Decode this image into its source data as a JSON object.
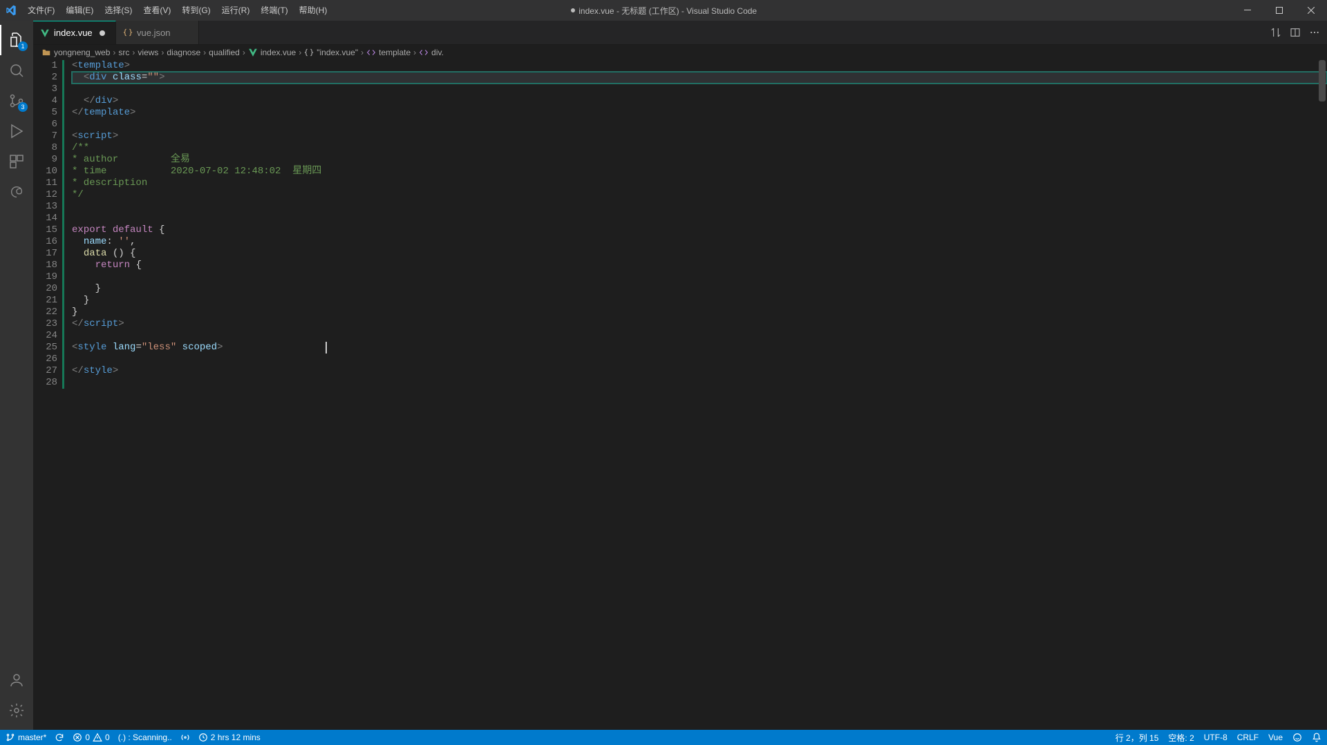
{
  "menu": {
    "file": "文件(F)",
    "edit": "编辑(E)",
    "selection": "选择(S)",
    "view": "查看(V)",
    "go": "转到(G)",
    "run": "运行(R)",
    "terminal": "终端(T)",
    "help": "帮助(H)"
  },
  "window": {
    "title_prefix": "● ",
    "title": "index.vue - 无标题 (工作区) - Visual Studio Code"
  },
  "activity": {
    "explorer_badge": "1",
    "scm_badge": "3"
  },
  "tabs": [
    {
      "label": "index.vue",
      "icon": "vue-file-icon",
      "active": true,
      "dirty": true
    },
    {
      "label": "vue.json",
      "icon": "json-file-icon",
      "active": false,
      "dirty": false
    }
  ],
  "breadcrumbs": [
    {
      "label": "yongneng_web",
      "icon": "folder-icon"
    },
    {
      "label": "src"
    },
    {
      "label": "views"
    },
    {
      "label": "diagnose"
    },
    {
      "label": "qualified"
    },
    {
      "label": "index.vue",
      "icon": "vue-file-icon"
    },
    {
      "label": "\"index.vue\"",
      "icon": "braces-icon"
    },
    {
      "label": "template",
      "icon": "symbol-html-icon"
    },
    {
      "label": "div.",
      "icon": "symbol-html-icon"
    }
  ],
  "editor": {
    "cursor_line": 25,
    "cursor_col": 46,
    "author": "全易",
    "timestamp": "2020-07-02 12:48:02  星期四"
  },
  "status": {
    "branch": "master*",
    "sync": "",
    "errors": "0",
    "warnings": "0",
    "scanning": "(.) : Scanning..",
    "live_server": "",
    "time": "2 hrs 12 mins",
    "ln_col": "行 2，列 15",
    "spaces": "空格: 2",
    "encoding": "UTF-8",
    "eol": "CRLF",
    "language": "Vue",
    "feedback": "",
    "bell": ""
  }
}
